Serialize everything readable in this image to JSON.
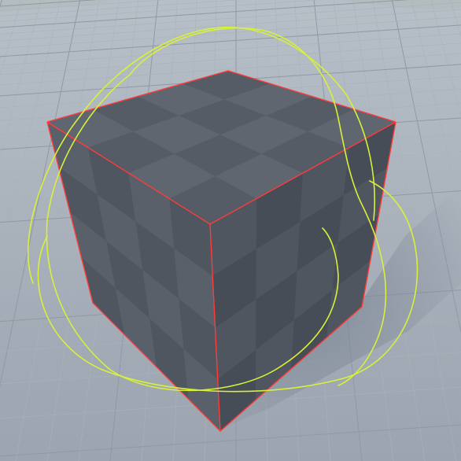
{
  "viewport": {
    "colors": {
      "sky_top": "#c9d0d6",
      "sky_bottom": "#aab3bc",
      "floor_near": "#9aa3ae",
      "floor_far": "#b5bdc6",
      "grid_minor": "#a9b2bc",
      "grid_major": "#8f99a5",
      "shadow": "#7d8795",
      "cube_top_light": "#5f6670",
      "cube_top_dark": "#555c66",
      "cube_left_light": "#59606a",
      "cube_left_dark": "#4f565f",
      "cube_right_light": "#4f565f",
      "cube_right_dark": "#474d56",
      "selection_outline": "#ff3b3b",
      "gizmo": "#d9f03a",
      "foliage": "#9db46a"
    },
    "icons": {
      "rotation_gizmo": "rotate-gizmo-icon"
    }
  }
}
